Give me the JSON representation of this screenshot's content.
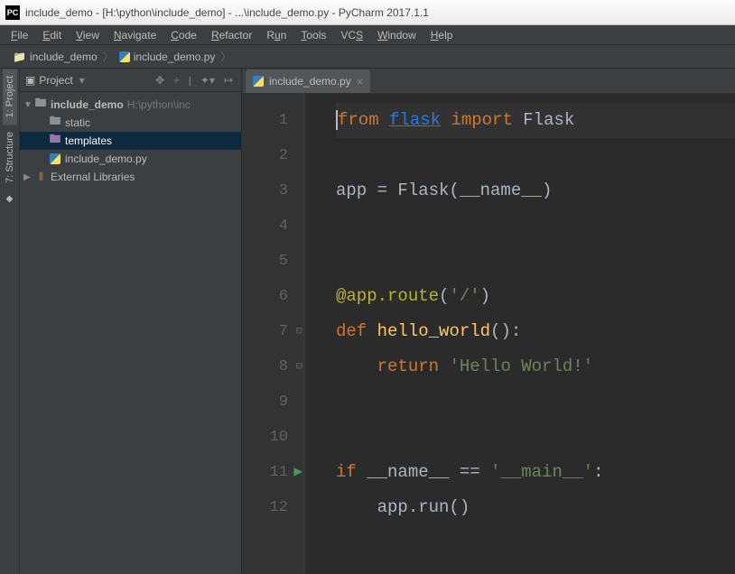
{
  "titlebar": {
    "icon_label": "PC",
    "text": "include_demo - [H:\\python\\include_demo] - ...\\include_demo.py - PyCharm 2017.1.1"
  },
  "menubar": [
    {
      "key": "F",
      "rest": "ile"
    },
    {
      "key": "E",
      "rest": "dit"
    },
    {
      "key": "V",
      "rest": "iew"
    },
    {
      "key": "N",
      "rest": "avigate"
    },
    {
      "key": "C",
      "rest": "ode"
    },
    {
      "key": "R",
      "rest": "efactor"
    },
    {
      "key": "R",
      "rest": "un",
      "pre": ""
    },
    {
      "key": "T",
      "rest": "ools"
    },
    {
      "key": "",
      "rest": "VC",
      "post": "S",
      "postkey": "S"
    },
    {
      "key": "W",
      "rest": "indow"
    },
    {
      "key": "H",
      "rest": "elp"
    }
  ],
  "breadcrumb": {
    "items": [
      {
        "icon": "dir",
        "label": "include_demo"
      },
      {
        "icon": "py",
        "label": "include_demo.py"
      }
    ]
  },
  "sidebar_tabs": {
    "project": "1: Project",
    "structure": "7: Structure"
  },
  "panel": {
    "title": "Project",
    "toolbar_icons": [
      "▾",
      "✥",
      "÷",
      "|",
      "✦",
      "▾",
      "↦"
    ]
  },
  "tree": {
    "root": {
      "label": "include_demo",
      "hint": "H:\\python\\inc"
    },
    "children": [
      {
        "icon": "folder",
        "label": "static"
      },
      {
        "icon": "folder-purple",
        "label": "templates",
        "selected": true
      },
      {
        "icon": "py",
        "label": "include_demo.py"
      }
    ],
    "external": "External Libraries"
  },
  "editor": {
    "tab": "include_demo.py",
    "lines": [
      {
        "n": "1",
        "hl": true,
        "seg": [
          {
            "cls": "caret"
          },
          {
            "cls": "kw",
            "t": "from"
          },
          {
            "t": " "
          },
          {
            "cls": "link",
            "t": "flask"
          },
          {
            "t": " "
          },
          {
            "cls": "kw",
            "t": "import"
          },
          {
            "t": " Flask"
          }
        ]
      },
      {
        "n": "2",
        "seg": []
      },
      {
        "n": "3",
        "seg": [
          {
            "t": "app = Flask(__name__)"
          }
        ]
      },
      {
        "n": "4",
        "seg": []
      },
      {
        "n": "5",
        "seg": []
      },
      {
        "n": "6",
        "seg": [
          {
            "cls": "deco",
            "t": "@app.route"
          },
          {
            "t": "("
          },
          {
            "cls": "str",
            "t": "'/'"
          },
          {
            "t": ")"
          }
        ]
      },
      {
        "n": "7",
        "icon": "⊟",
        "seg": [
          {
            "cls": "kw",
            "t": "def"
          },
          {
            "t": " "
          },
          {
            "cls": "fn",
            "t": "hello_world"
          },
          {
            "t": "():"
          }
        ]
      },
      {
        "n": "8",
        "icon": "⊟",
        "seg": [
          {
            "t": "    "
          },
          {
            "cls": "kw",
            "t": "return"
          },
          {
            "t": " "
          },
          {
            "cls": "str",
            "t": "'Hello World!'"
          }
        ]
      },
      {
        "n": "9",
        "seg": []
      },
      {
        "n": "10",
        "seg": []
      },
      {
        "n": "11",
        "run": true,
        "seg": [
          {
            "cls": "kw",
            "t": "if"
          },
          {
            "t": " __name__ == "
          },
          {
            "cls": "str",
            "t": "'__main__'"
          },
          {
            "t": ":"
          }
        ]
      },
      {
        "n": "12",
        "seg": [
          {
            "t": "    app.run()"
          }
        ]
      }
    ]
  }
}
